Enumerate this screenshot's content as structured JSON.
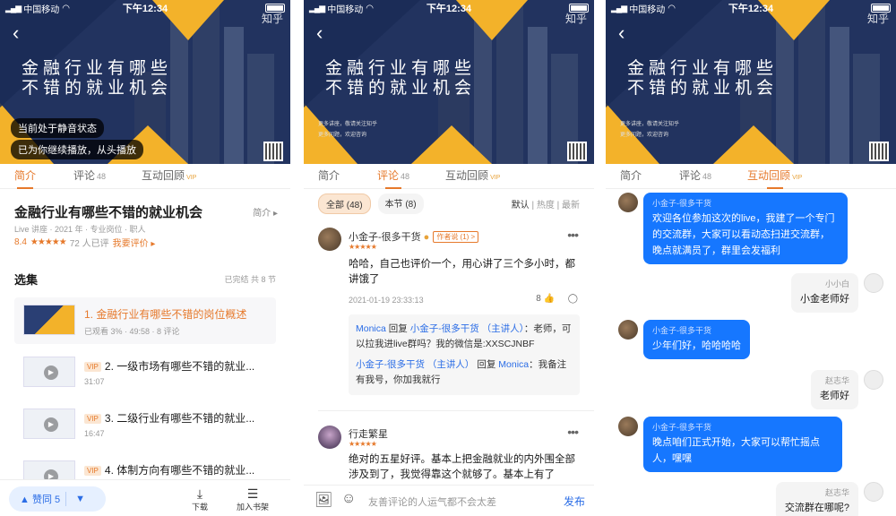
{
  "status": {
    "carrier": "中国移动",
    "time": "下午12:34",
    "brand": "知乎"
  },
  "banner": {
    "title_line1": "金融行业有哪些",
    "title_line2": "不错的就业机会",
    "info_line1": "更多讲座，敬请关注知乎",
    "info_line2": "更多问题，欢迎咨询"
  },
  "toasts": {
    "mute": "当前处于静音状态",
    "resume": "已为你继续播放，从头播放"
  },
  "tabs": {
    "intro": "简介",
    "comments": "评论",
    "comments_count": "48",
    "qa": "互动回顾",
    "vip": "VIP"
  },
  "s1": {
    "title": "金融行业有哪些不错的就业机会",
    "intro_link": "简介 ▸",
    "meta": "Live 讲座 · 2021 年 · 专业岗位 · 职人",
    "score": "8.4",
    "rating_count": "72 人已评",
    "rate_link": "我要评价 ▸",
    "section_title": "选集",
    "section_meta": "已完结 共 8 节",
    "episodes": [
      {
        "title": "1. 金融行业有哪些不错的岗位概述",
        "sub": "已观看 3% · 49:58 · 8 评论",
        "vip": ""
      },
      {
        "title": "2. 一级市场有哪些不错的就业...",
        "sub": "31:07",
        "vip": "VIP"
      },
      {
        "title": "3. 二级行业有哪些不错的就业...",
        "sub": "16:47",
        "vip": "VIP"
      },
      {
        "title": "4. 体制方向有哪些不错的就业...",
        "sub": "",
        "vip": "VIP"
      }
    ],
    "like_label": "▲ 赞同 5",
    "down_label": "▼",
    "download": "下载",
    "bookshelf": "加入书架"
  },
  "s2": {
    "chip_all": "全部 (48)",
    "chip_section": "本节 (8)",
    "sort": [
      "默认",
      "热度",
      "最新"
    ],
    "c1": {
      "name": "小金子-很多干货",
      "tag": "作者说 (1) >",
      "text": "哈哈，自己也评价一个，用心讲了三个多小时，都讲饿了",
      "time": "2021-01-19 23:33:13",
      "likes": "8"
    },
    "replies": [
      {
        "user": "Monica",
        "verb": "回复",
        "target": "小金子-很多干货 （主讲人）",
        "text": "：老师，可以拉我进live群吗？我的微信是:XXSCJNBF"
      },
      {
        "user": "小金子-很多干货 （主讲人）",
        "verb": "回复",
        "target": "Monica",
        "text": "：我备注有我号，你加我就行"
      }
    ],
    "c2": {
      "name": "行走繁星",
      "text": "绝对的五星好评。基本上把金融就业的内外围全部涉及到了，我觉得靠这个就够了。基本上有了"
    },
    "input_placeholder": "友善评论的人运气都不会太差",
    "publish": "发布"
  },
  "s3": {
    "messages": [
      {
        "side": "left",
        "name": "小金子-很多干货",
        "text": "欢迎各位参加这次的live，我建了一个专门的交流群，大家可以看动态扫进交流群，晚点就满员了，群里会发福利"
      },
      {
        "side": "right",
        "name": "小小白",
        "text": "小金老师好"
      },
      {
        "side": "left",
        "name": "小金子-很多干货",
        "text": "少年们好，哈哈哈哈"
      },
      {
        "side": "right",
        "name": "赵志华",
        "text": "老师好"
      },
      {
        "side": "left",
        "name": "小金子-很多干货",
        "text": "晚点咱们正式开始，大家可以帮忙摇点人，嘿嘿"
      },
      {
        "side": "right",
        "name": "赵志华",
        "text": "交流群在哪呢?"
      }
    ]
  },
  "colors": {
    "accent": "#e6792b",
    "blue": "#1677ff",
    "banner_navy": "#1d2f5e",
    "banner_yellow": "#f3b22a"
  }
}
